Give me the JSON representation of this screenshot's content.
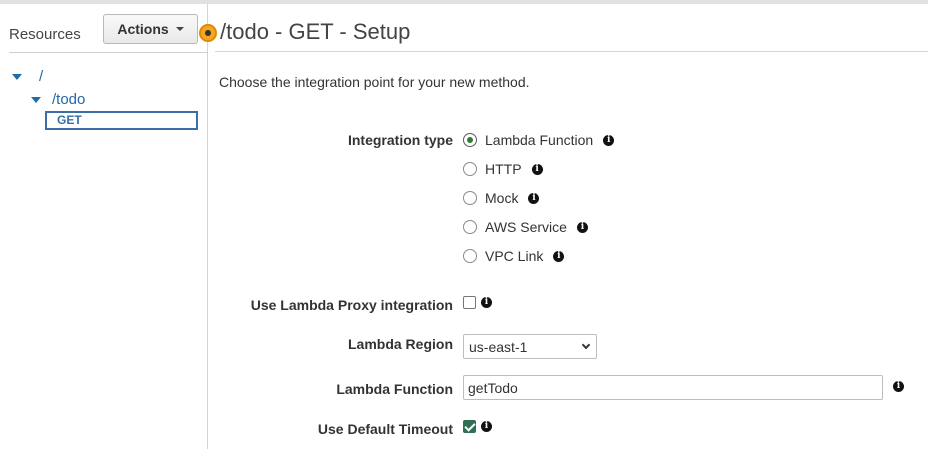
{
  "sidebar": {
    "title": "Resources",
    "actions_label": "Actions",
    "tree": {
      "root": "/",
      "child": "/todo",
      "method": "GET"
    }
  },
  "header": {
    "title": "/todo - GET - Setup"
  },
  "main": {
    "intro": "Choose the integration point for your new method.",
    "integration_type": {
      "label": "Integration type",
      "selected": "Lambda Function",
      "options": [
        "Lambda Function",
        "HTTP",
        "Mock",
        "AWS Service",
        "VPC Link"
      ]
    },
    "proxy": {
      "label": "Use Lambda Proxy integration",
      "checked": false
    },
    "region": {
      "label": "Lambda Region",
      "value": "us-east-1"
    },
    "function": {
      "label": "Lambda Function",
      "value": "getTodo"
    },
    "timeout": {
      "label": "Use Default Timeout",
      "checked": true
    }
  },
  "colors": {
    "link": "#2466a7",
    "radio_selected": "#2e7d32",
    "checkbox_checked": "#2f6f54",
    "status_dot": "#f5a623"
  },
  "icons": {
    "info": "info-icon",
    "tree_expand": "caret-down-icon",
    "status": "status-dot-icon"
  }
}
